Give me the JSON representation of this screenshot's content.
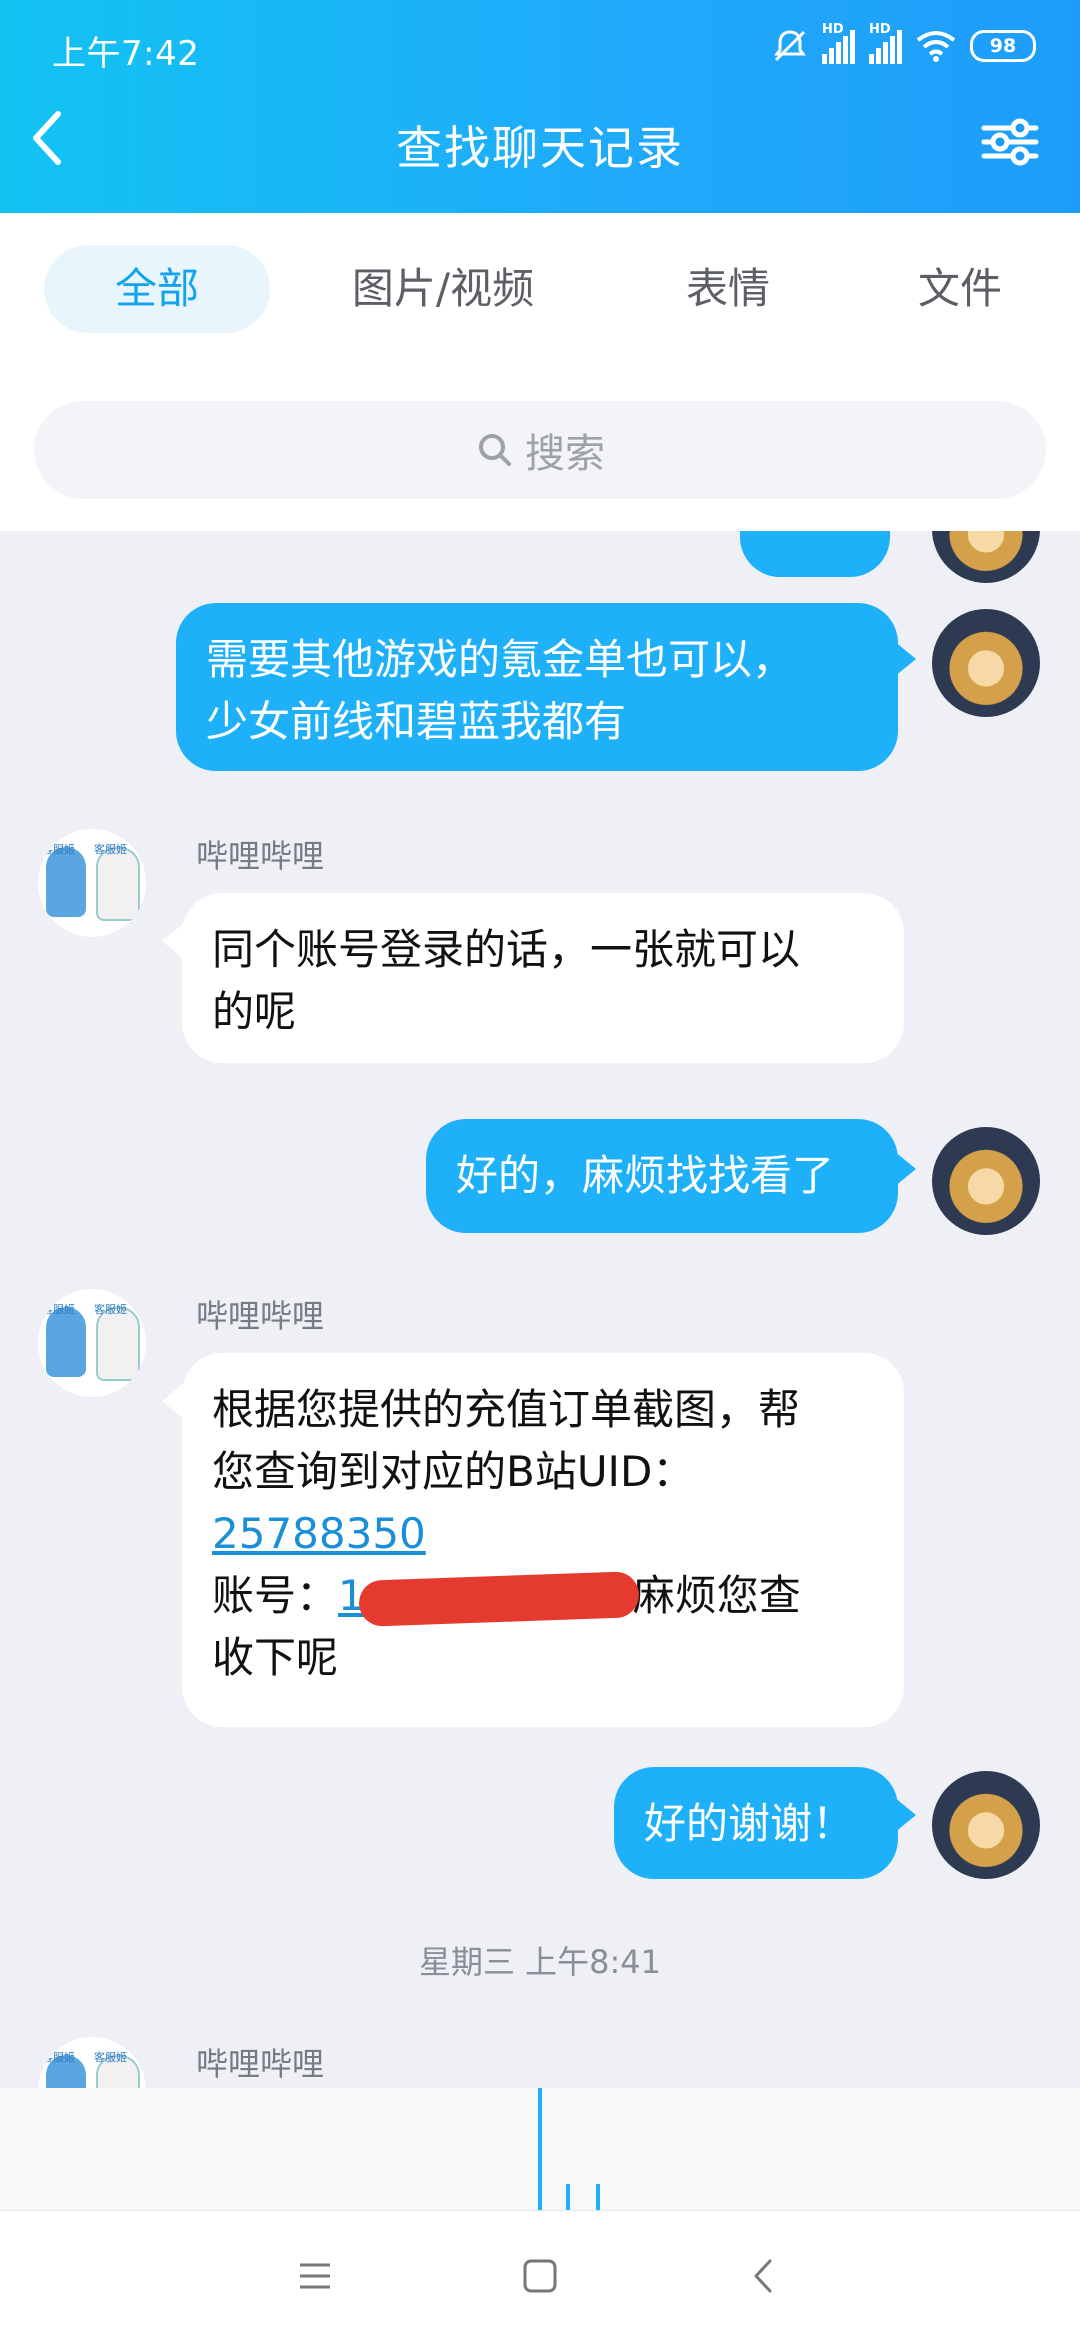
{
  "status_bar": {
    "time": "上午7:42",
    "battery": "98",
    "network_1": "HD",
    "network_2": "HD"
  },
  "header": {
    "title": "查找聊天记录"
  },
  "tabs": [
    {
      "label": "全部",
      "active": true
    },
    {
      "label": "图片/视频",
      "active": false
    },
    {
      "label": "表情",
      "active": false
    },
    {
      "label": "文件",
      "active": false
    }
  ],
  "search": {
    "placeholder": "搜索"
  },
  "messages": {
    "m1": {
      "lines": [
        "需要其他游戏的氪金单也可以，",
        "少女前线和碧蓝我都有"
      ]
    },
    "m2": {
      "sender": "哔哩哔哩",
      "lines": [
        "同个账号登录的话，一张就可以",
        "的呢"
      ]
    },
    "m3": {
      "text": "好的，麻烦找找看了"
    },
    "m4": {
      "sender": "哔哩哔哩",
      "line1": "根据您提供的充值订单截图，帮",
      "line2": "您查询到对应的B站UID：",
      "uid": "25788350",
      "account_label": " 账号：",
      "account_visible": "1",
      "account_suffix": "麻烦您查",
      "line5": "收下呢"
    },
    "m5": {
      "text": "好的谢谢！"
    },
    "timestamp": "星期三 上午8:41",
    "m6": {
      "sender": "哔哩哔哩"
    }
  },
  "avatar_badge": "客服姬",
  "colors": {
    "accent": "#1fb0fa",
    "header_start": "#12c3f2",
    "header_end": "#1d9df9",
    "link": "#1a8fd8"
  }
}
